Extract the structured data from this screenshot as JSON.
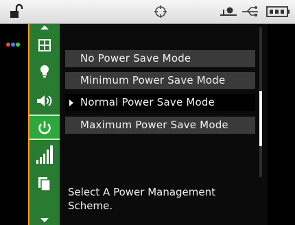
{
  "status_bar": {
    "icons": [
      "unlock-icon",
      "crosshair-icon",
      "usb-device-icon",
      "usb-icon",
      "battery-icon"
    ]
  },
  "colors": {
    "border": "#f29a1f",
    "nav_green": "#2a7b32",
    "nav_selected": "#2ea83c",
    "option_bg": "#3a3a3a",
    "dot_red": "#e24b4b",
    "dot_blue": "#4b7fe2",
    "dot_green": "#44c84a"
  },
  "nav": {
    "items": [
      "grid-icon",
      "bulb-icon",
      "speaker-icon",
      "power-icon",
      "signal-bars-icon",
      "copy-pages-icon"
    ],
    "selected": "power-icon"
  },
  "menu": {
    "options": [
      {
        "label": "No Power Save Mode",
        "selected": false
      },
      {
        "label": "Minimum Power Save Mode",
        "selected": false
      },
      {
        "label": "Normal Power Save Mode",
        "selected": true
      },
      {
        "label": "Maximum Power Save Mode",
        "selected": false
      }
    ]
  },
  "prompt": {
    "text": "Select A Power Management Scheme."
  }
}
